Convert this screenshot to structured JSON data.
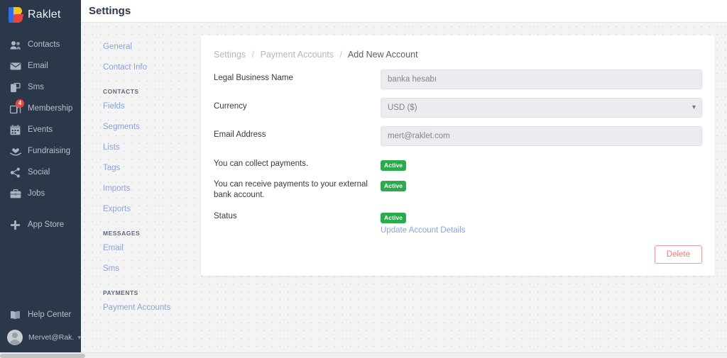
{
  "brand": {
    "name": "Raklet",
    "logo_icon": "raklet-logo-icon"
  },
  "sidebar": {
    "items": [
      {
        "label": "Contacts",
        "icon": "contacts-icon",
        "badge": null
      },
      {
        "label": "Email",
        "icon": "envelope-icon",
        "badge": null
      },
      {
        "label": "Sms",
        "icon": "sms-icon",
        "badge": null
      },
      {
        "label": "Membership",
        "icon": "membership-icon",
        "badge": "4"
      },
      {
        "label": "Events",
        "icon": "calendar-icon",
        "badge": null
      },
      {
        "label": "Fundraising",
        "icon": "fundraising-icon",
        "badge": null
      },
      {
        "label": "Social",
        "icon": "share-icon",
        "badge": null
      },
      {
        "label": "Jobs",
        "icon": "briefcase-icon",
        "badge": null
      },
      {
        "label": "App Store",
        "icon": "plus-icon",
        "badge": null
      }
    ],
    "bottom_items": [
      {
        "label": "Help Center",
        "icon": "book-icon"
      }
    ],
    "user": {
      "name": "Mervet@Rak...",
      "avatar_icon": "user-avatar-icon",
      "caret_icon": "chevron-down-icon"
    }
  },
  "header": {
    "title": "Settings"
  },
  "settings_nav": {
    "top_links": [
      {
        "label": "General"
      },
      {
        "label": "Contact Info"
      }
    ],
    "groups": [
      {
        "title": "CONTACTS",
        "links": [
          {
            "label": "Fields"
          },
          {
            "label": "Segments"
          },
          {
            "label": "Lists"
          },
          {
            "label": "Tags"
          },
          {
            "label": "Imports"
          },
          {
            "label": "Exports"
          }
        ]
      },
      {
        "title": "MESSAGES",
        "links": [
          {
            "label": "Email"
          },
          {
            "label": "Sms"
          }
        ]
      },
      {
        "title": "PAYMENTS",
        "links": [
          {
            "label": "Payment Accounts"
          }
        ]
      }
    ]
  },
  "card": {
    "breadcrumb": {
      "root": "Settings",
      "middle": "Payment Accounts",
      "current": "Add New Account",
      "separator": "/"
    },
    "fields": {
      "legal_business_name": {
        "label": "Legal Business Name",
        "value": "banka hesabı",
        "placeholder": "banka hesabı"
      },
      "currency": {
        "label": "Currency",
        "value": "USD ($)",
        "options": [
          "USD ($)"
        ],
        "caret_icon": "chevron-down-icon"
      },
      "email_address": {
        "label": "Email Address",
        "value": "mert@raklet.com",
        "placeholder": "mert@raklet.com"
      }
    },
    "statuses": [
      {
        "label": "You can collect payments.",
        "badge": "Active"
      },
      {
        "label": "You can receive payments to your external bank account.",
        "badge": "Active"
      },
      {
        "label": "Status",
        "badge": "Active",
        "link": "Update Account Details"
      }
    ],
    "delete_button": "Delete"
  },
  "colors": {
    "sidebar_bg": "#2b3849",
    "badge_green": "#2bab4c",
    "link_blue": "#8ba2de",
    "delete_red": "#e87b7b",
    "notification_red": "#e8453c"
  }
}
